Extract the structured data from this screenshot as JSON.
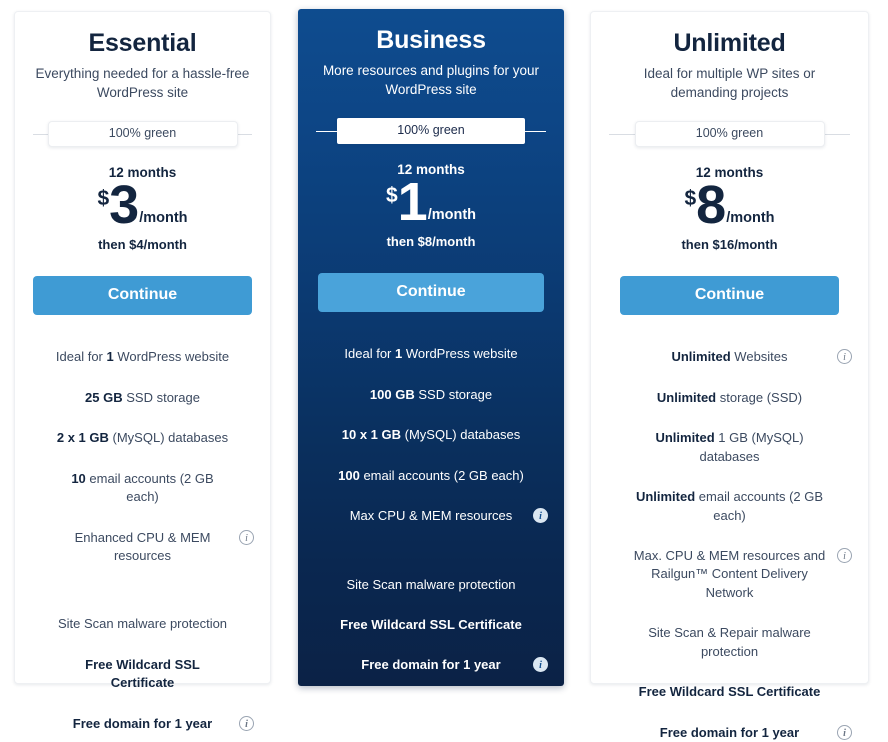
{
  "plans": [
    {
      "id": "essential",
      "name": "Essential",
      "tagline": "Everything needed for a hassle-free WordPress site",
      "green_badge": "100% green",
      "term": "12 months",
      "currency": "$",
      "amount": "3",
      "period": "/month",
      "then_price": "then $4/month",
      "cta": "Continue",
      "features": [
        {
          "html": "Ideal for <b>1</b> WordPress website",
          "info": false
        },
        {
          "html": "<b>25 GB</b> SSD storage",
          "info": false
        },
        {
          "html": "<b>2 x 1 GB</b> (MySQL) databases",
          "info": false
        },
        {
          "html": "<b>10</b> email accounts (2 GB each)",
          "info": false
        },
        {
          "html": "Enhanced CPU &amp; MEM resources",
          "info": true
        },
        {
          "html": "Site Scan malware protection",
          "info": false,
          "gap": true
        },
        {
          "html": "Free Wildcard SSL Certificate",
          "info": false,
          "strong": true
        },
        {
          "html": "Free domain for 1 year",
          "info": true,
          "strong": true
        }
      ]
    },
    {
      "id": "business",
      "name": "Business",
      "tagline": "More resources and plugins for your WordPress site",
      "green_badge": "100% green",
      "term": "12 months",
      "currency": "$",
      "amount": "1",
      "period": "/month",
      "then_price": "then $8/month",
      "cta": "Continue",
      "features": [
        {
          "html": "Ideal for <b>1</b> WordPress website",
          "info": false
        },
        {
          "html": "<b>100 GB</b> SSD storage",
          "info": false
        },
        {
          "html": "<b>10 x 1 GB</b> (MySQL) databases",
          "info": false
        },
        {
          "html": "<b>100</b> email accounts (2 GB each)",
          "info": false
        },
        {
          "html": "Max CPU &amp; MEM resources",
          "info": true
        },
        {
          "html": "Site Scan malware protection",
          "info": false,
          "gap": true
        },
        {
          "html": "Free Wildcard SSL Certificate",
          "info": false,
          "strong": true
        },
        {
          "html": "Free domain for 1 year",
          "info": true,
          "strong": true
        }
      ]
    },
    {
      "id": "unlimited",
      "name": "Unlimited",
      "tagline": "Ideal for multiple WP sites or demanding projects",
      "green_badge": "100% green",
      "term": "12 months",
      "currency": "$",
      "amount": "8",
      "period": "/month",
      "then_price": "then $16/month",
      "cta": "Continue",
      "features": [
        {
          "html": "<b>Unlimited</b> Websites",
          "info": true
        },
        {
          "html": "<b>Unlimited</b> storage (SSD)",
          "info": false
        },
        {
          "html": "<b>Unlimited</b> 1 GB (MySQL) databases",
          "info": false
        },
        {
          "html": "<b>Unlimited</b> email accounts (2 GB each)",
          "info": false
        },
        {
          "html": "Max. CPU &amp; MEM resources and Railgun™ Content Delivery Network",
          "info": true
        },
        {
          "html": "Site Scan &amp; Repair malware protection",
          "info": false
        },
        {
          "html": "Free Wildcard SSL Certificate",
          "info": false,
          "strong": true
        },
        {
          "html": "Free domain for 1 year",
          "info": true,
          "strong": true
        }
      ]
    }
  ],
  "icons": {
    "info": "i"
  },
  "colors": {
    "accent_button": "#3f9bd4",
    "featured_card_top": "#0e4c8f",
    "featured_card_bottom": "#0b2246",
    "heading": "#13253f",
    "body_text": "#3c4a60"
  }
}
